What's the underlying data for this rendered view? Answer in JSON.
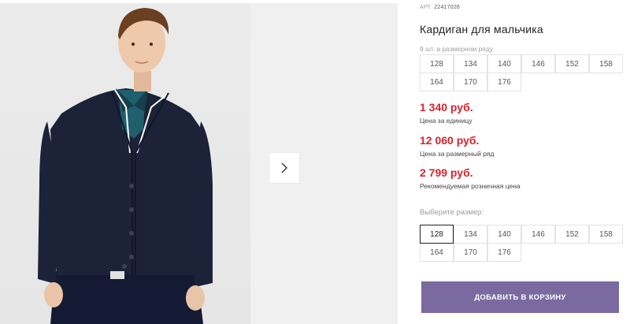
{
  "product": {
    "sku_label": "АРТ.",
    "sku_value": "22417026",
    "title": "Кардиган для мальчика",
    "sizes_note": "9 шт. в размерном ряду",
    "size_row_sizes": [
      "128",
      "134",
      "140",
      "146",
      "152",
      "158",
      "164",
      "170",
      "176"
    ],
    "prices": {
      "unit_price": "1 340 руб.",
      "unit_label": "Цена за единицу",
      "row_price": "12 060 руб.",
      "row_label": "Цена за размерный ряд",
      "retail_price": "2 799 руб.",
      "retail_label": "Рекомендуемая розничная цена"
    },
    "choose_size_label": "Выберите размер:",
    "size_options": [
      "128",
      "134",
      "140",
      "146",
      "152",
      "158",
      "164",
      "170",
      "176"
    ],
    "selected_size": "128",
    "add_to_cart_label": "ДОБАВИТЬ В КОРЗИНУ"
  },
  "gallery": {
    "next_icon": "chevron-right-icon"
  },
  "colors": {
    "price_red": "#d9222d",
    "button_purple": "#7a6aa0",
    "cardigan_navy": "#1c2238",
    "polo_teal": "#1f5f6e"
  }
}
